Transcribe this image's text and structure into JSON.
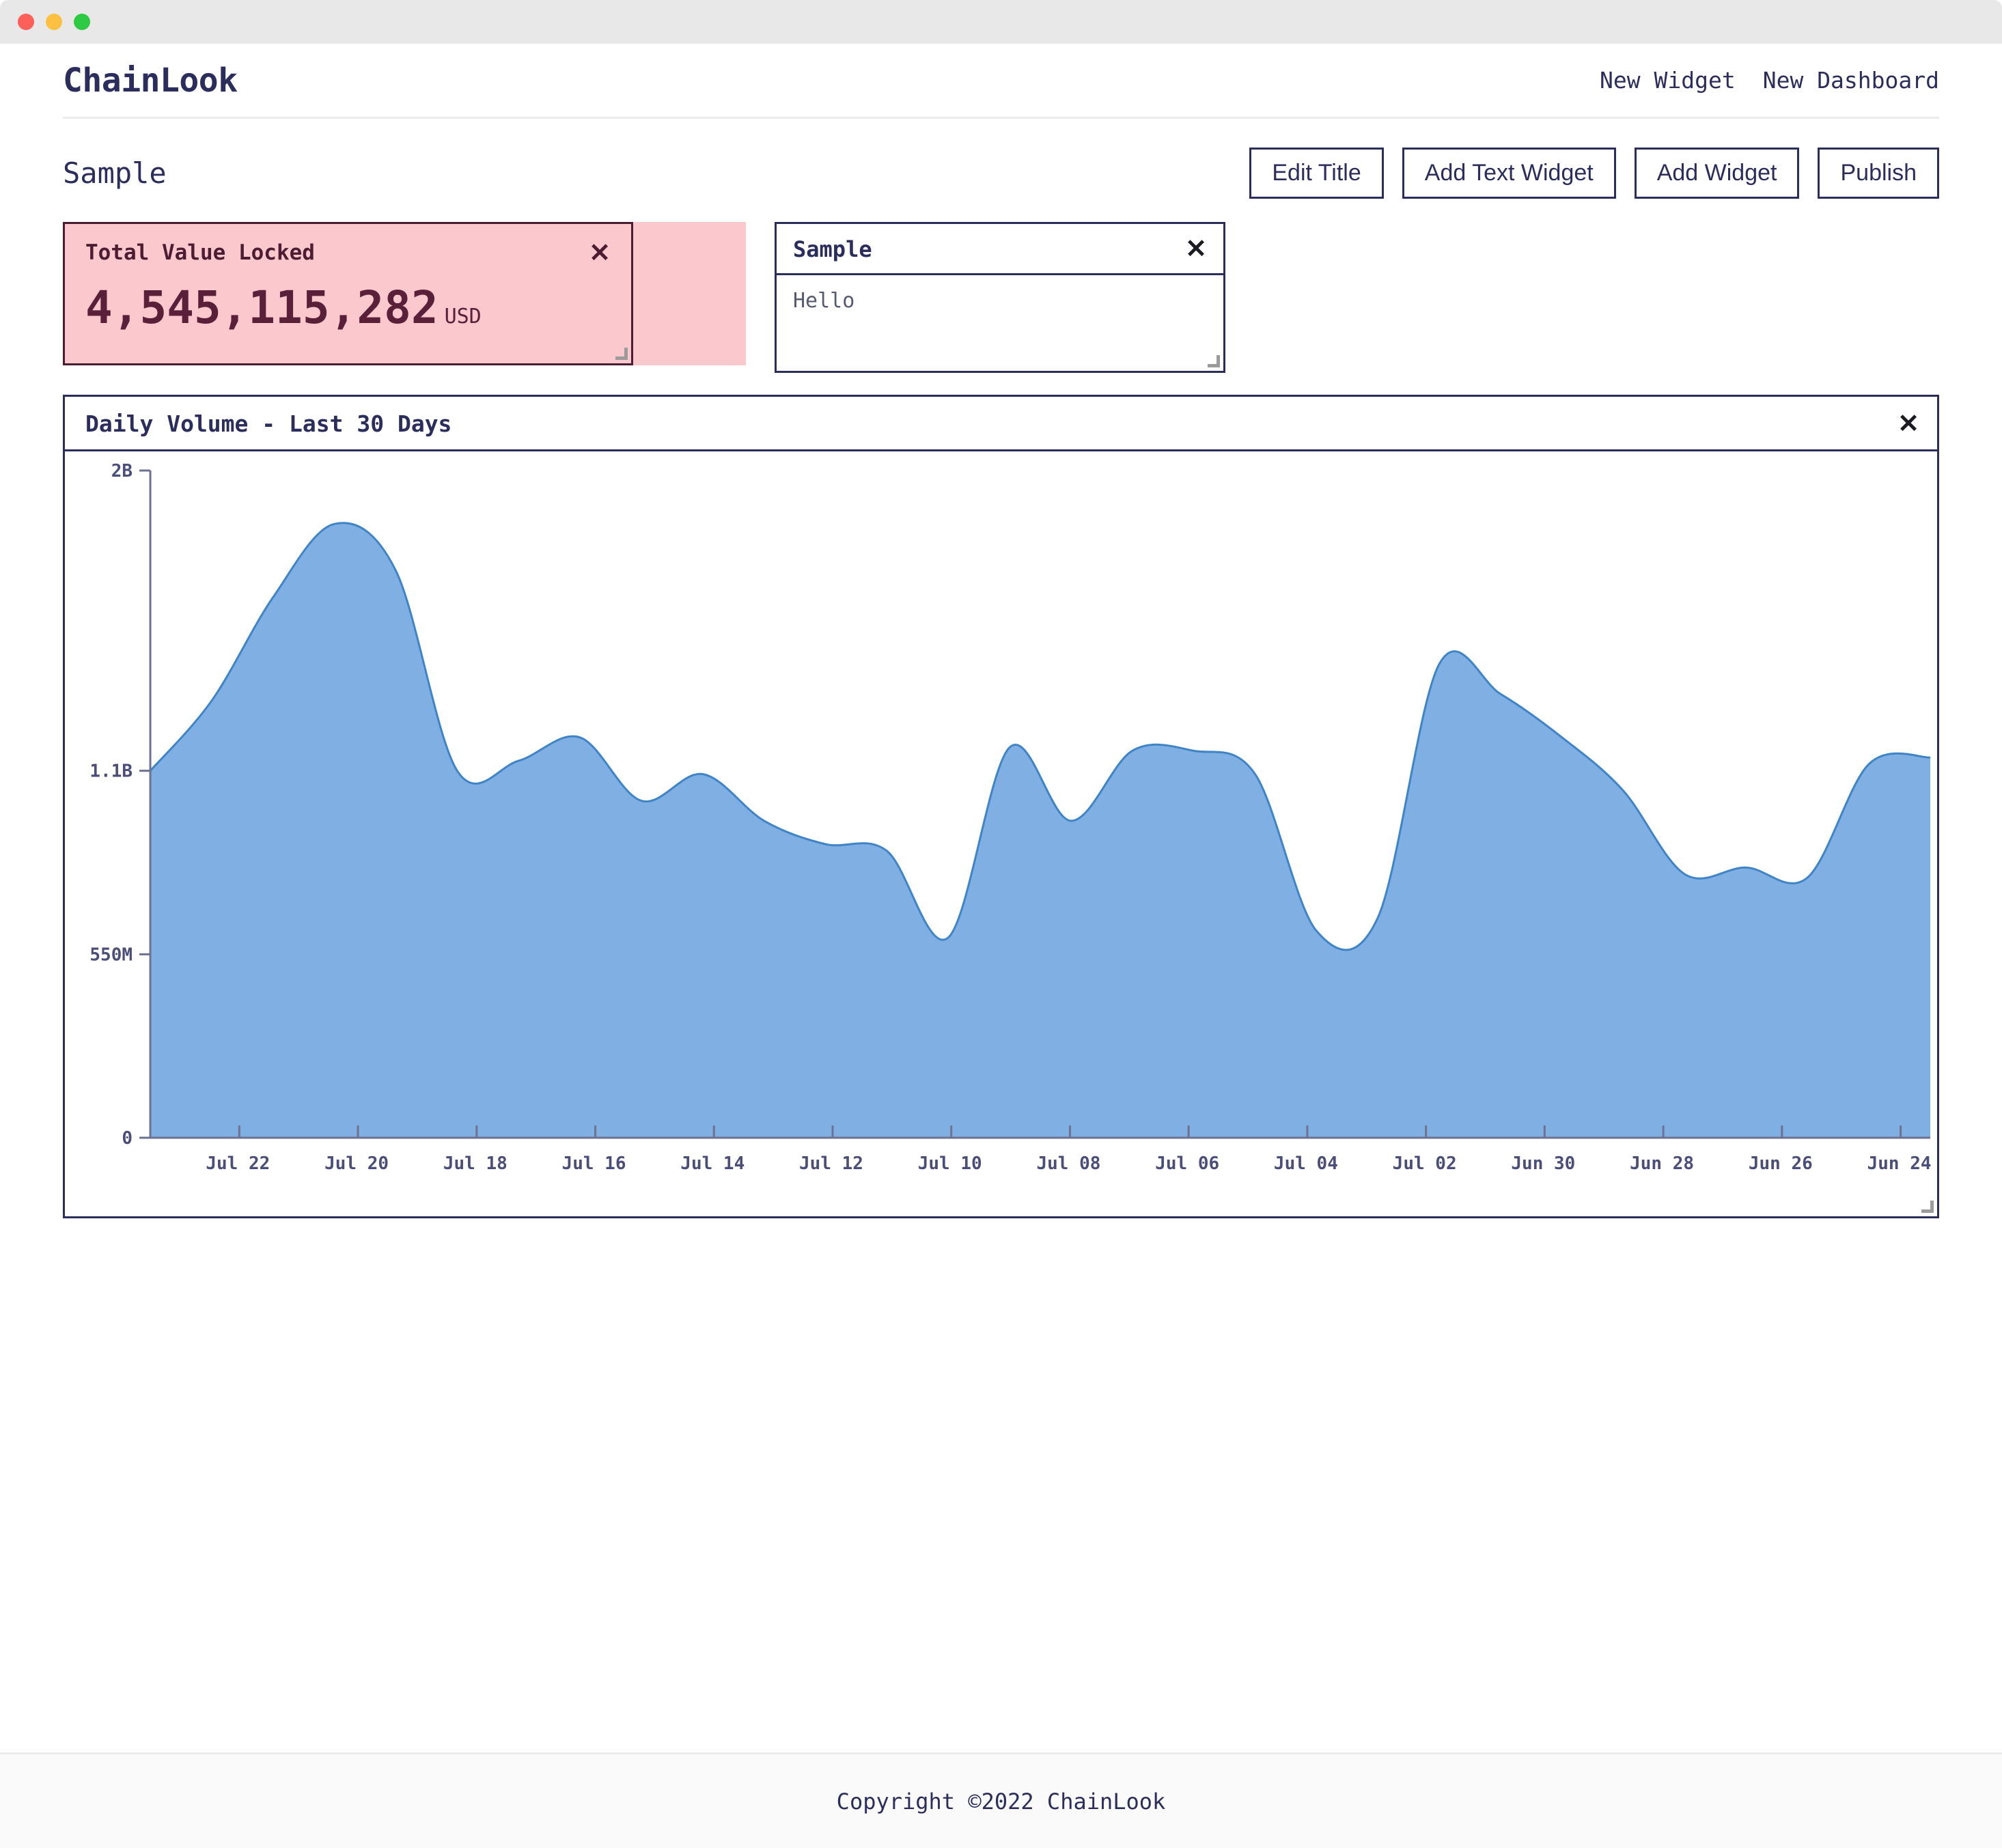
{
  "window": {
    "traffic_lights": [
      "close",
      "minimize",
      "maximize"
    ]
  },
  "header": {
    "brand": "ChainLook",
    "nav": [
      {
        "label": "New Widget",
        "name": "new-widget"
      },
      {
        "label": "New Dashboard",
        "name": "new-dashboard"
      }
    ]
  },
  "toolbar": {
    "dashboard_title": "Sample",
    "buttons": [
      {
        "label": "Edit Title"
      },
      {
        "label": "Add Text Widget"
      },
      {
        "label": "Add Widget"
      },
      {
        "label": "Publish"
      }
    ]
  },
  "metric_widget": {
    "title": "Total Value Locked",
    "value": "4,545,115,282",
    "unit": "USD",
    "close_label": "✕",
    "bg_color": "#fbc9cd",
    "border_color": "#4c1d32",
    "text_color": "#5b2039"
  },
  "text_widget": {
    "title": "Sample",
    "body": "Hello",
    "placeholder": "Hello",
    "close_label": "✕"
  },
  "chart_widget": {
    "title": "Daily Volume - Last 30 Days",
    "close_label": "✕"
  },
  "footer": {
    "copyright": "Copyright ©2022 ChainLook"
  },
  "colors": {
    "accent": "#2b2d5c",
    "area_fill": "#80b0e3",
    "area_stroke": "#3f84c6",
    "axis": "#6e7292",
    "pink": "#fbc9cd",
    "maroon": "#4c1d32"
  },
  "chart_data": {
    "type": "area",
    "title": "Daily Volume - Last 30 Days",
    "xlabel": "",
    "ylabel": "",
    "grid": false,
    "legend": "none",
    "curve": "smooth",
    "ylim": [
      0,
      2000000000
    ],
    "ytick_values": [
      0,
      550000000,
      1100000000,
      2000000000
    ],
    "ytick_labels": [
      "0",
      "550M",
      "1.1B",
      "2B"
    ],
    "xtick_labels": [
      "Jul 22",
      "Jul 20",
      "Jul 18",
      "Jul 16",
      "Jul 14",
      "Jul 12",
      "Jul 10",
      "Jul 08",
      "Jul 06",
      "Jul 04",
      "Jul 02",
      "Jun 30",
      "Jun 28",
      "Jun 26",
      "Jun 24"
    ],
    "x": [
      "Jul 23",
      "Jul 22",
      "Jul 21",
      "Jul 20",
      "Jul 19",
      "Jul 18",
      "Jul 17",
      "Jul 16",
      "Jul 15",
      "Jul 14",
      "Jul 13",
      "Jul 12",
      "Jul 11",
      "Jul 10",
      "Jul 09",
      "Jul 08",
      "Jul 07",
      "Jul 06",
      "Jul 05",
      "Jul 04",
      "Jul 03",
      "Jul 02",
      "Jul 01",
      "Jun 30",
      "Jun 29",
      "Jun 28",
      "Jun 27",
      "Jun 26",
      "Jun 25",
      "Jun 24"
    ],
    "values": [
      1100000000,
      1310000000,
      1620000000,
      1840000000,
      1700000000,
      1100000000,
      1130000000,
      1200000000,
      1010000000,
      1090000000,
      950000000,
      880000000,
      860000000,
      600000000,
      1170000000,
      950000000,
      1160000000,
      1160000000,
      1090000000,
      620000000,
      660000000,
      1420000000,
      1330000000,
      1200000000,
      1040000000,
      790000000,
      810000000,
      780000000,
      1120000000,
      1140000000
    ]
  }
}
